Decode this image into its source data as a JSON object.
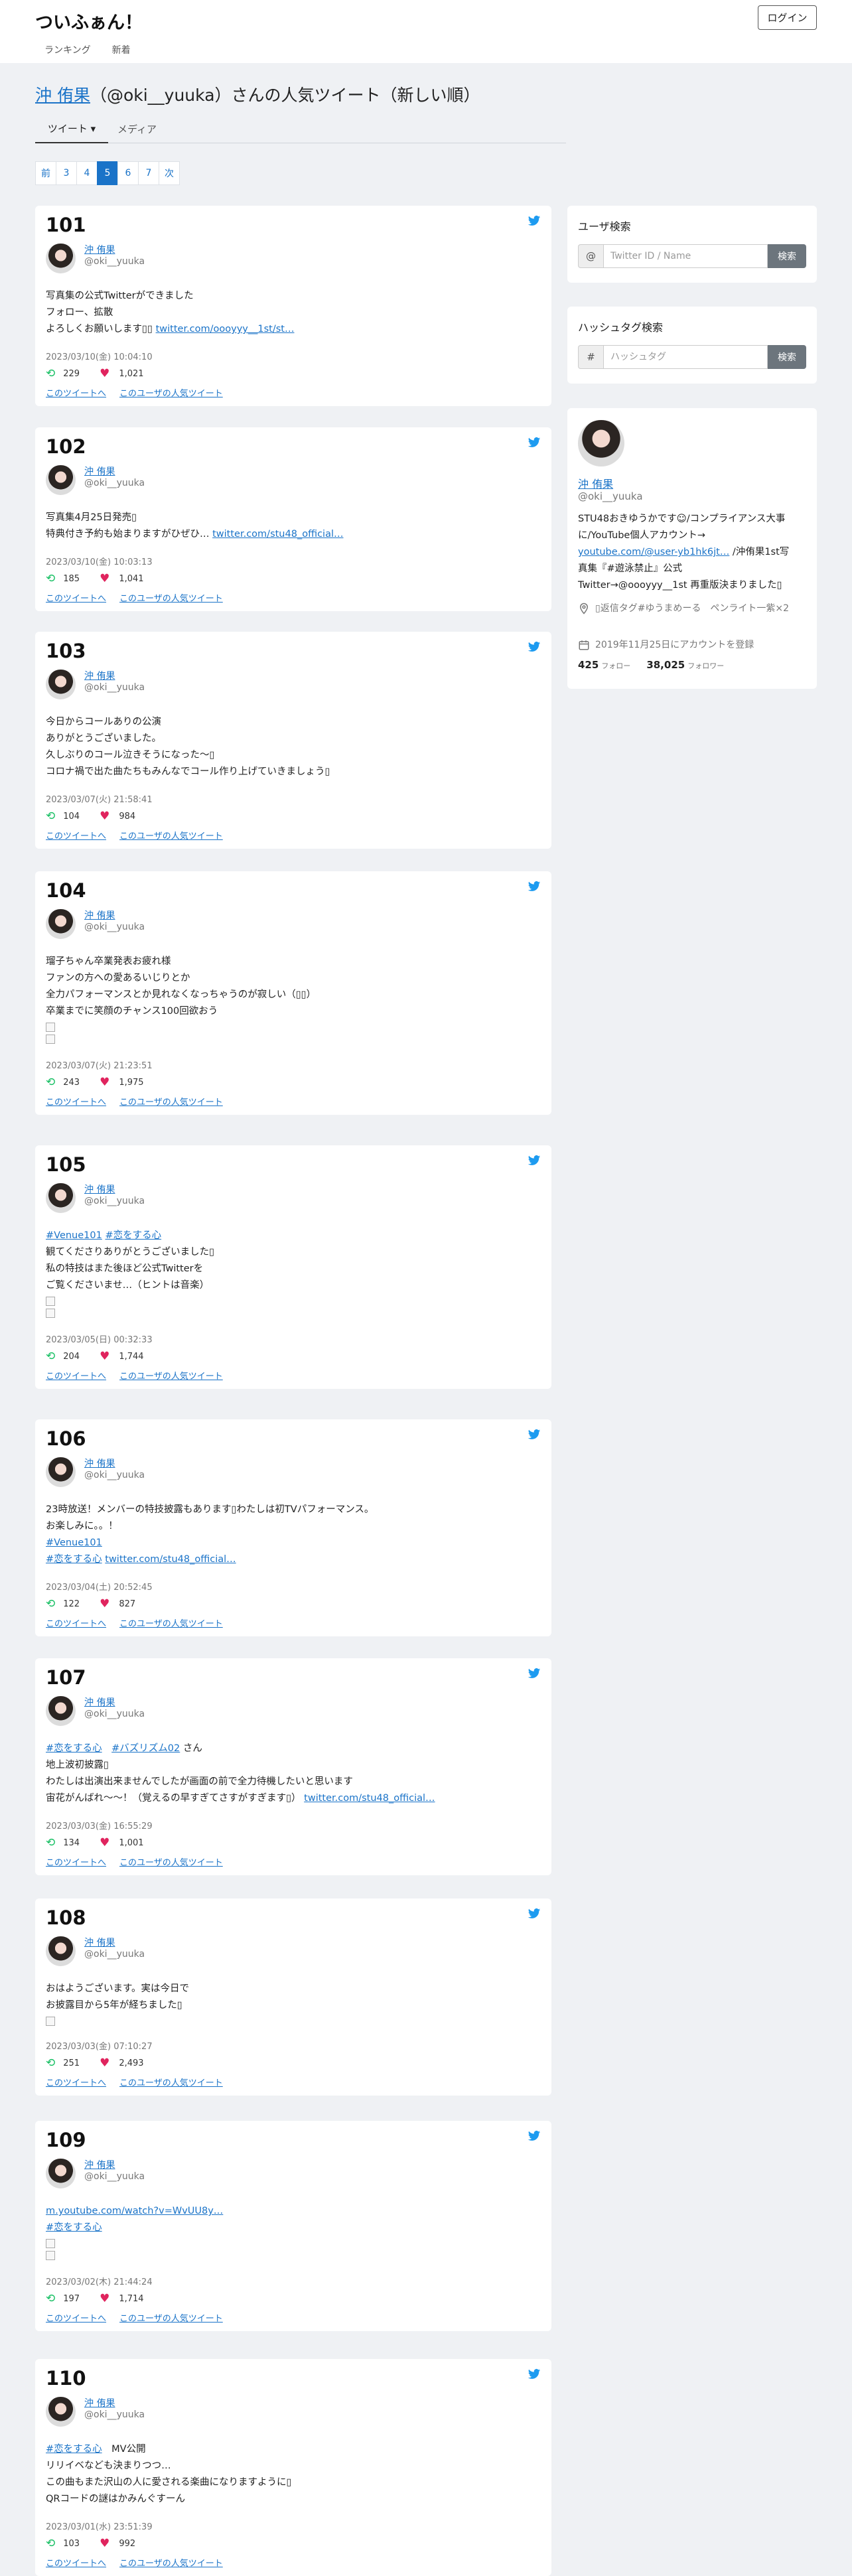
{
  "header": {
    "brand": "ついふぁん！",
    "login": "ログイン",
    "nav": [
      "ランキング",
      "新着"
    ]
  },
  "page": {
    "title_name": "沖 侑果",
    "title_rest": "（@oki__yuuka）さんの人気ツイート（新しい順）",
    "tabs": [
      "ツイート ▾",
      "メディア"
    ]
  },
  "pager": [
    "前",
    "3",
    "4",
    "5",
    "6",
    "7",
    "次"
  ],
  "pager_active": "5",
  "user": {
    "name": "沖 侑果",
    "handle": "@oki__yuuka"
  },
  "links": {
    "this_tweet": "このツイートへ",
    "user_popular": "このユーザの人気ツイート"
  },
  "tweets": [
    {
      "rank": "101",
      "lines": [
        "写真集の公式Twitterができました",
        "フォロー、拡散",
        "よろしくお願いします▯▯ <a>twitter.com/oooyyy__1st/st…</a>"
      ],
      "images": 0,
      "time": "2023/03/10(金) 10:04:10",
      "rt": "229",
      "fav": "1,021"
    },
    {
      "rank": "102",
      "lines": [
        "写真集4月25日発売▯",
        "特典付き予約も始まりますがひぜひ… <a>twitter.com/stu48_official…</a>"
      ],
      "images": 0,
      "time": "2023/03/10(金) 10:03:13",
      "rt": "185",
      "fav": "1,041"
    },
    {
      "rank": "103",
      "lines": [
        "今日からコールありの公演",
        "ありがとうございました。",
        "久しぶりのコール泣きそうになった〜▯",
        "コロナ禍で出た曲たちもみんなでコール作り上げていきましょう▯"
      ],
      "images": 0,
      "time": "2023/03/07(火) 21:58:41",
      "rt": "104",
      "fav": "984"
    },
    {
      "rank": "104",
      "lines": [
        "瑠子ちゃん卒業発表お疲れ様",
        "ファンの方への愛あるいじりとか",
        "全力パフォーマンスとか見れなくなっちゃうのが寂しい（▯▯）",
        "卒業までに笑顔のチャンス100回欲おう"
      ],
      "images": 2,
      "time": "2023/03/07(火) 21:23:51",
      "rt": "243",
      "fav": "1,975"
    },
    {
      "rank": "105",
      "lines": [
        "<a>#Venue101</a> <a>#恋をする心</a>",
        "観てくださりありがとうございました▯",
        "私の特技はまた後ほど公式Twitterを",
        "ご覧くださいませ…（ヒントは音楽）"
      ],
      "images": 2,
      "time": "2023/03/05(日) 00:32:33",
      "rt": "204",
      "fav": "1,744"
    },
    {
      "rank": "106",
      "lines": [
        "23時放送！メンバーの特技披露もあります▯わたしは初TVパフォーマンス。",
        "お楽しみに。。！",
        "<a>#Venue101</a>",
        "<a>#恋をする心</a> <a>twitter.com/stu48_official…</a>"
      ],
      "images": 0,
      "time": "2023/03/04(土) 20:52:45",
      "rt": "122",
      "fav": "827"
    },
    {
      "rank": "107",
      "lines": [
        "<a>#恋をする心</a>　<a>#バズリズム02</a> さん",
        "地上波初披露▯",
        "わたしは出演出来ませんでしたが画面の前で全力待機したいと思います",
        "宙花がんばれ〜〜！（覚えるの早すぎてさすがすぎます▯） <a>twitter.com/stu48_official…</a>"
      ],
      "images": 0,
      "time": "2023/03/03(金) 16:55:29",
      "rt": "134",
      "fav": "1,001"
    },
    {
      "rank": "108",
      "lines": [
        "おはようございます。実は今日で",
        "お披露目から5年が経ちました▯"
      ],
      "images": 1,
      "time": "2023/03/03(金) 07:10:27",
      "rt": "251",
      "fav": "2,493"
    },
    {
      "rank": "109",
      "lines": [
        "<a>m.youtube.com/watch?v=WvUU8y…</a>",
        "<a>#恋をする心</a>"
      ],
      "images": 2,
      "time": "2023/03/02(木) 21:44:24",
      "rt": "197",
      "fav": "1,714"
    },
    {
      "rank": "110",
      "lines": [
        "<a>#恋をする心</a>　MV公開",
        "リリイベなども決まりつつ…",
        "この曲もまた沢山の人に愛される楽曲になりますように▯",
        "QRコードの謎はかみんぐすーん"
      ],
      "images": 0,
      "time": "2023/03/01(水) 23:51:39",
      "rt": "103",
      "fav": "992"
    }
  ],
  "sidebar": {
    "user_search": {
      "title": "ユーザ検索",
      "prefix": "@",
      "placeholder": "Twitter ID / Name",
      "button": "検索"
    },
    "hashtag_search": {
      "title": "ハッシュタグ検索",
      "prefix": "#",
      "placeholder": "ハッシュタグ",
      "button": "検索"
    },
    "profile": {
      "name": "沖 侑果",
      "handle": "@oki__yuuka",
      "bio_lines": [
        "STU48おきゆうかです☺︎/コンプライアンス大事",
        "に/YouTube個人アカウント→",
        "<a>youtube.com/@user-yb1hk6jt…</a> /沖侑果1st写",
        "真集『#遊泳禁止』公式",
        "Twitter→@oooyyy__1st 再重版決まりました▯"
      ],
      "location": "▯返信タグ#ゆうまめーる　ペンライト一紫×2",
      "created": "2019年11月25日にアカウントを登録",
      "follow_count": "425",
      "follow_label": "フォロー",
      "follower_count": "38,025",
      "follower_label": "フォロワー"
    }
  }
}
